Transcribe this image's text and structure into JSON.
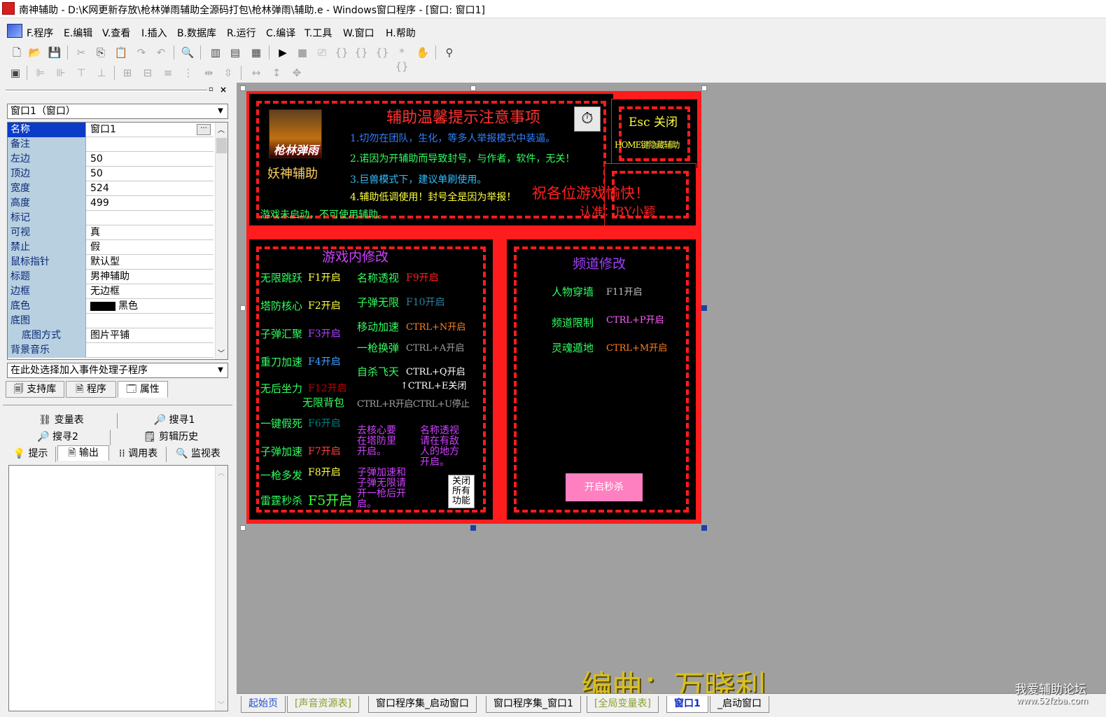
{
  "window": {
    "title": "南神辅助 - D:\\K网更新存放\\枪林弹雨辅助全源码打包\\枪林弹雨\\辅助.e - Windows窗口程序 - [窗口: 窗口1]"
  },
  "menu": [
    "F.程序",
    "E.编辑",
    "V.查看",
    "I.插入",
    "B.数据库",
    "R.运行",
    "C.编译",
    "T.工具",
    "W.窗口",
    "H.帮助"
  ],
  "left_panel": {
    "object_combo": "窗口1（窗口）",
    "properties": [
      {
        "name": "名称",
        "value": "窗口1",
        "selected": true
      },
      {
        "name": "备注",
        "value": ""
      },
      {
        "name": "左边",
        "value": "50"
      },
      {
        "name": "顶边",
        "value": "50"
      },
      {
        "name": "宽度",
        "value": "524"
      },
      {
        "name": "高度",
        "value": "499"
      },
      {
        "name": "标记",
        "value": ""
      },
      {
        "name": "可视",
        "value": "真"
      },
      {
        "name": "禁止",
        "value": "假"
      },
      {
        "name": "鼠标指针",
        "value": "默认型"
      },
      {
        "name": "标题",
        "value": "男神辅助"
      },
      {
        "name": "边框",
        "value": "无边框"
      },
      {
        "name": "底色",
        "value": "黑色"
      },
      {
        "name": "底图",
        "value": ""
      },
      {
        "name": "底图方式",
        "value": "图片平铺",
        "sub": true
      },
      {
        "name": "背景音乐",
        "value": ""
      }
    ],
    "event_combo": "在此处选择加入事件处理子程序",
    "tabs": [
      "支持库",
      "程序",
      "属性"
    ],
    "output_tabs_row1": [
      "变量表",
      "搜寻1"
    ],
    "output_tabs_row2": [
      "搜寻2",
      "剪辑历史"
    ],
    "output_tabs_row3": [
      "提示",
      "输出",
      "调用表",
      "监视表"
    ]
  },
  "design": {
    "logo_text": "枪林弹雨",
    "app_name": "妖神辅助",
    "notice_title": "辅助温馨提示注意事项",
    "notices": [
      "1.切勿在团队，生化，等多人举报模式中装逼。",
      "2.诺因为开辅助而导致封号，与作者，软件，无关！",
      "3.巨兽模式下，建议单刷使用。",
      "4.辅助低调使用！封号全是因为举报！"
    ],
    "esc_label": "Esc 关闭",
    "home_label": "HOME键隐藏辅助",
    "greeting": "祝各位游戏愉快！",
    "author": "认准：BY小颖",
    "status": "游戏未启动，不可使用辅助。",
    "ingame_title": "游戏内修改",
    "col1": [
      {
        "name": "无限跳跃",
        "key": "F1开启",
        "key_color": "#ffff40"
      },
      {
        "name": "塔防核心",
        "key": "F2开启",
        "key_color": "#ffff40"
      },
      {
        "name": "子弹汇聚",
        "key": "F3开启",
        "key_color": "#b040ff"
      },
      {
        "name": "重刀加速",
        "key": "F4开启",
        "key_color": "#40a0ff"
      },
      {
        "name": "无后坐力",
        "key": "F12开启",
        "key_color": "#c00000"
      },
      {
        "name": "一键假死",
        "key": "F6开启",
        "key_color": "#008080"
      },
      {
        "name": "子弹加速",
        "key": "F7开启",
        "key_color": "#ff4040"
      },
      {
        "name": "一枪多发",
        "key": "F8开启",
        "key_color": "#ffff40"
      },
      {
        "name": "雷霆秒杀",
        "key": "F5开启",
        "key_color": "#40ff40"
      }
    ],
    "infinite_bag": "无限背包",
    "col2": [
      {
        "name": "名称透视",
        "key": "F9开启",
        "key_color": "#ff2020"
      },
      {
        "name": "子弹无限",
        "key": "F10开启",
        "key_color": "#3080a0"
      },
      {
        "name": "移动加速",
        "key": "CTRL+N开启",
        "key_color": "#ff8020"
      },
      {
        "name": "一枪换弹",
        "key": "CTRL+A开启",
        "key_color": "#a0a0a0"
      },
      {
        "name": "自杀飞天",
        "key": "CTRL+Q开启",
        "key_color": "#ffffff"
      }
    ],
    "ctrl_e": "↑CTRL+E关闭",
    "ctrl_r": "CTRL+R开启CTRL+U停止",
    "note1": "去核心要在塔防里开启。",
    "note2": "名称透视请在有敌人的地方开启。",
    "note3": "子弹加速和子弹无限请开一枪后开启。",
    "close_all": "关闭所有功能",
    "channel_title": "频道修改",
    "channel": [
      {
        "name": "人物穿墙",
        "key": "F11开启",
        "key_color": "#c0c0c0"
      },
      {
        "name": "频道限制",
        "key": "CTRL+P开启",
        "key_color": "#ff60ff"
      },
      {
        "name": "灵魂遁地",
        "key": "CTRL+M开启",
        "key_color": "#ff8020"
      }
    ],
    "kill_button": "开启秒杀"
  },
  "watermark": "编曲：万晓利",
  "site": {
    "name": "我爱辅助论坛",
    "url": "www.52fzba.com"
  },
  "bottom_tabs": [
    "起始页",
    "[声音资源表]",
    "窗口程序集_启动窗口",
    "窗口程序集_窗口1",
    "[全局变量表]",
    "窗口1",
    "_启动窗口"
  ]
}
